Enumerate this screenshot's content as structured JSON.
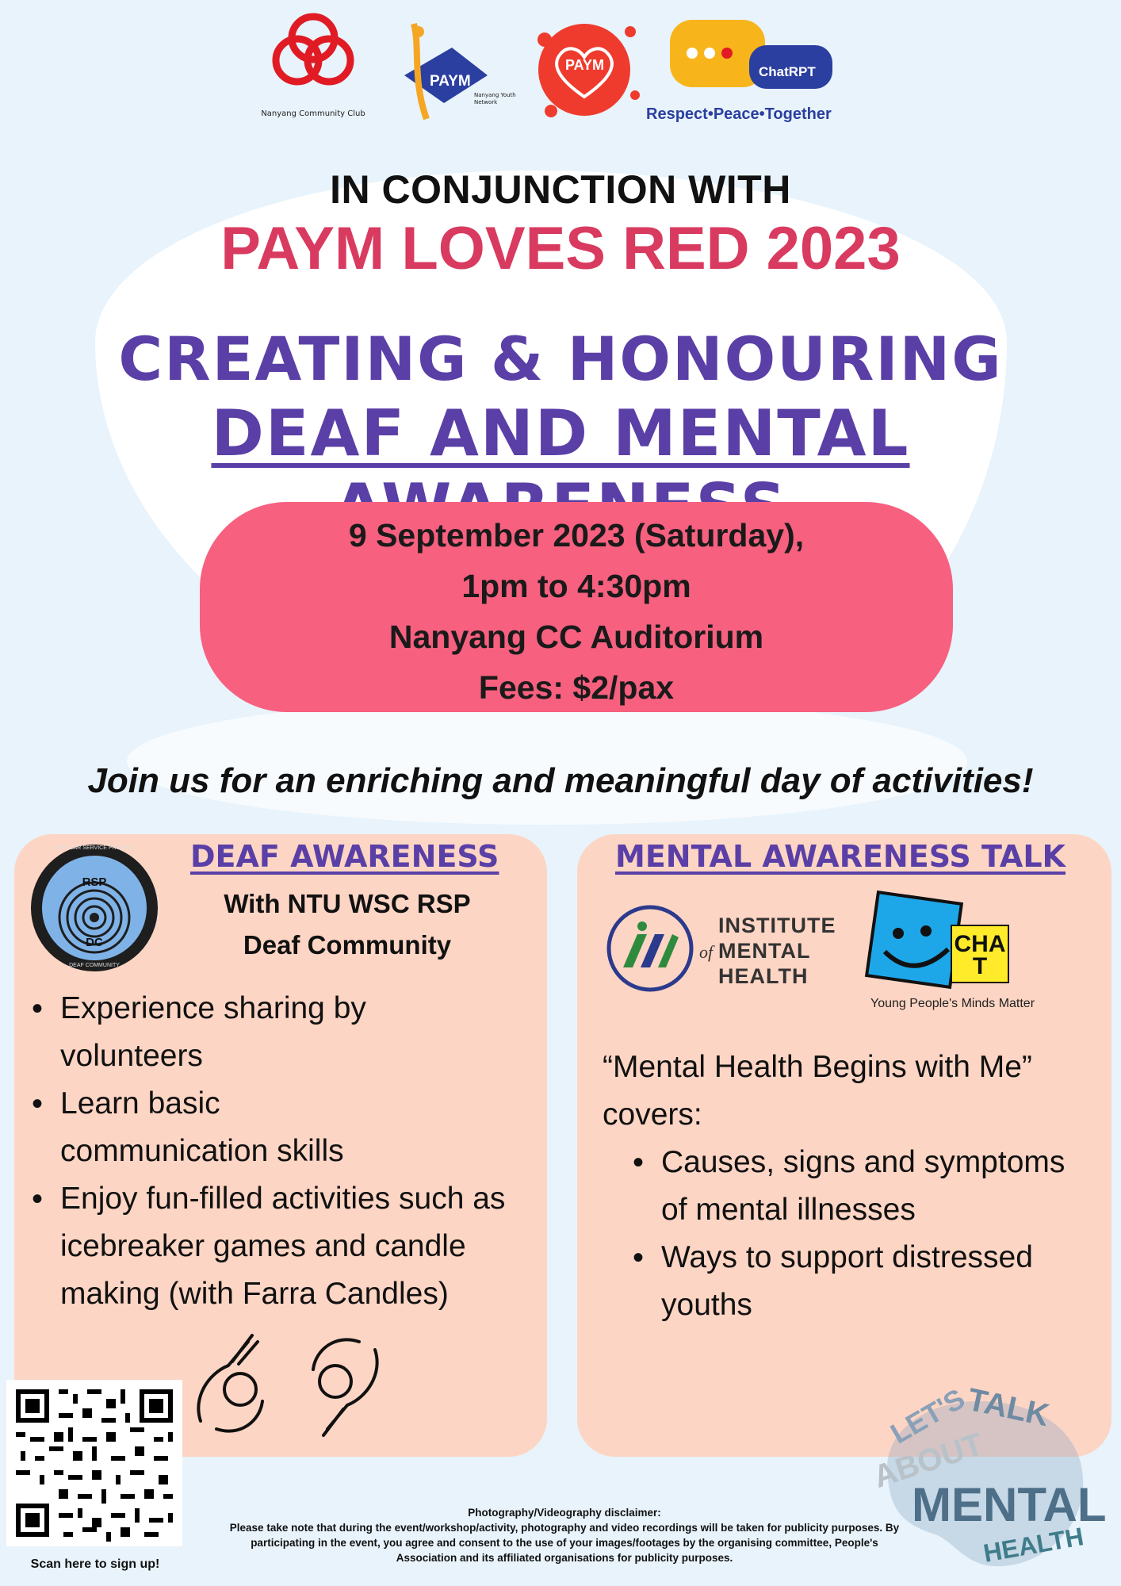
{
  "header": {
    "nanyang_cc_caption": "Nanyang Community Club",
    "paym_logo_text": "PAYM",
    "paym_network_caption": "Nanyang Youth Network",
    "paym_heart_text": "PAYM",
    "chatrpt_text": "ChatRPT",
    "tagline": "Respect•Peace•Together"
  },
  "headline": {
    "conjunction": "IN CONJUNCTION WITH",
    "event": "PAYM LOVES RED 2023",
    "title_line1": "CREATING & HONOURING",
    "title_line2": "DEAF AND MENTAL AWARENESS"
  },
  "details": {
    "date": "9 September 2023 (Saturday),",
    "time": "1pm to 4:30pm",
    "venue": "Nanyang CC Auditorium",
    "fees": "Fees: $2/pax"
  },
  "join_text": "Join us for an enriching and meaningful day of activities!",
  "deaf": {
    "heading": "DEAF AWARENESS",
    "with_line1": "With NTU WSC RSP",
    "with_line2": "Deaf Community",
    "badge_top": "REGULAR SERVICE PROJECT",
    "badge_rsp": "RSP",
    "badge_dc": "DC",
    "badge_bottom": "DEAF COMMUNITY",
    "bullets": [
      "Experience sharing by volunteers",
      "Learn basic communication skills",
      "Enjoy fun-filled activities such as icebreaker games and candle making (with Farra Candles)"
    ]
  },
  "mental": {
    "heading": "MENTAL AWARENESS TALK",
    "imh_line1": "INSTITUTE",
    "imh_of": "of",
    "imh_line2": "MENTAL",
    "imh_line3": "HEALTH",
    "chat_logo": "CHAT",
    "chat_tagline": "Young People's Minds Matter",
    "intro": "“Mental Health Begins with Me” covers:",
    "bullets": [
      "Causes, signs and symptoms of mental illnesses",
      "Ways to support distressed youths"
    ],
    "lets_talk_words": [
      "LET'S",
      "TALK",
      "ABOUT",
      "MENTAL",
      "HEALTH"
    ]
  },
  "signup": {
    "caption": "Scan here to sign up!"
  },
  "disclaimer": {
    "title": "Photography/Videography disclaimer:",
    "body": "Please take note that during the event/workshop/activity, photography and video recordings will be taken for publicity purposes. By participating in the event, you agree and consent to the use of your images/footages by the organising committee, People's Association and its affiliated organisations for publicity purposes."
  },
  "colors": {
    "background": "#e8f3fb",
    "accent_red": "#d93a5f",
    "purple": "#5a3fa7",
    "pill": "#f7607f",
    "panel": "#fdd5c4"
  }
}
